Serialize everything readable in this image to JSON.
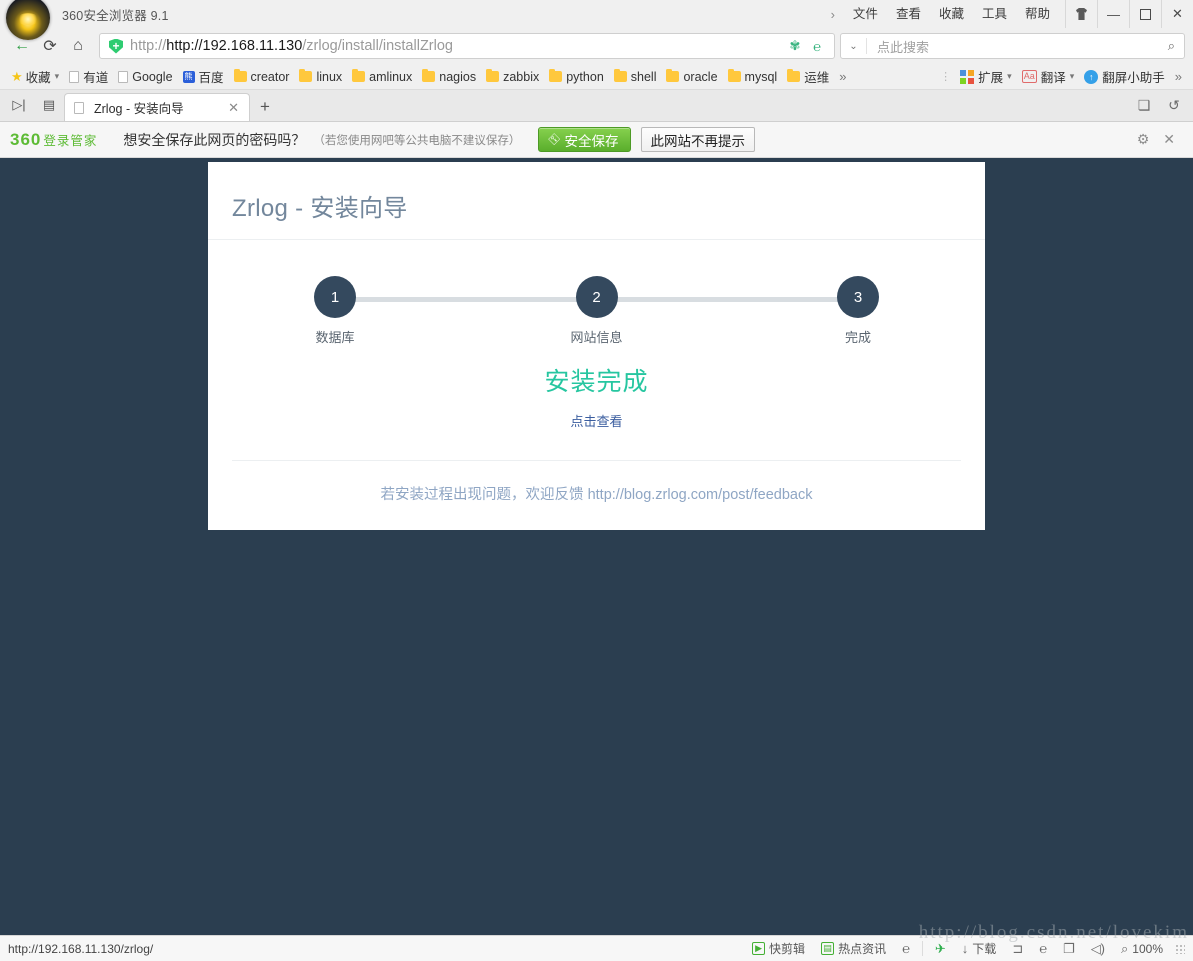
{
  "titlebar": {
    "app_title": "360安全浏览器 9.1",
    "logo_name": "360-browser-logo",
    "overflow_chevron": "›",
    "menus": [
      "文件",
      "查看",
      "收藏",
      "工具",
      "帮助"
    ],
    "window_buttons": {
      "skin": "",
      "minimize": "—",
      "maximize": "❐",
      "close": "✕"
    }
  },
  "navbar": {
    "back": "←",
    "reload": "⟳",
    "home": "⌂",
    "url_secure_part": "http://192.168.11.130",
    "url_path_part": "/zrlog/install/installZrlog",
    "url_full": "http://192.168.11.130/zrlog/install/installZrlog",
    "addr_icons": [
      "安全检测",
      "极速/兼容模式"
    ],
    "search": {
      "placeholder": "点此搜索",
      "dropdown": "⌄",
      "submit_icon": "search-icon"
    }
  },
  "bookmarks": {
    "root_label": "收藏",
    "items": [
      {
        "label": "有道",
        "type": "page"
      },
      {
        "label": "Google",
        "type": "page"
      },
      {
        "label": "百度",
        "type": "baidu"
      },
      {
        "label": "creator",
        "type": "folder"
      },
      {
        "label": "linux",
        "type": "folder"
      },
      {
        "label": "amlinux",
        "type": "folder"
      },
      {
        "label": "nagios",
        "type": "folder"
      },
      {
        "label": "zabbix",
        "type": "folder"
      },
      {
        "label": "python",
        "type": "folder"
      },
      {
        "label": "shell",
        "type": "folder"
      },
      {
        "label": "oracle",
        "type": "folder"
      },
      {
        "label": "mysql",
        "type": "folder"
      },
      {
        "label": "运维",
        "type": "folder"
      }
    ],
    "overflow": "»",
    "right_items": [
      {
        "label": "扩展",
        "icon": "extensions-icon",
        "caret": "▾"
      },
      {
        "label": "翻译",
        "icon": "translate-icon",
        "caret": "▾"
      },
      {
        "label": "翻屏小助手",
        "icon": "page-turn-icon",
        "caret": ""
      }
    ],
    "right_overflow": "»"
  },
  "tabstrip": {
    "lead_buttons": [
      "侧边栏",
      "手机预览"
    ],
    "tabs": [
      {
        "title": "Zrlog - 安装向导",
        "close": "✕",
        "active": true
      }
    ],
    "new_tab": "+",
    "right_buttons": [
      "窗口列表",
      "撤销关闭"
    ]
  },
  "password_bar": {
    "brand_main": "360",
    "brand_sub": "登录管家",
    "message": "想安全保存此网页的密码吗？",
    "hint": "（若您使用网吧等公共电脑不建议保存）",
    "save_button": "安全保存",
    "never_button": "此网站不再提示",
    "settings_icon": "⚙",
    "close_icon": "✕"
  },
  "page": {
    "title": "Zrlog - 安装向导",
    "steps": [
      {
        "number": "1",
        "label": "数据库"
      },
      {
        "number": "2",
        "label": "网站信息"
      },
      {
        "number": "3",
        "label": "完成"
      }
    ],
    "result_title": "安装完成",
    "result_link": "点击查看",
    "footer_text": "若安装过程出现问题，欢迎反馈 http://blog.zrlog.com/post/feedback",
    "colors": {
      "page_background": "#2b3e50",
      "card_background": "#ffffff",
      "title_color": "#73879c",
      "step_circle": "#34495e",
      "step_line": "#d8dde1",
      "success_green": "#26c6a0",
      "link_blue": "#3a5d9f",
      "footer_blue": "#8fa6c4"
    }
  },
  "statusbar": {
    "url": "http://192.168.11.130/zrlog/",
    "items": [
      {
        "label": "快剪辑",
        "icon": "video-edit-icon"
      },
      {
        "label": "热点资讯",
        "icon": "news-icon"
      },
      {
        "label": "",
        "icon": "ad-filter-icon"
      },
      {
        "label": "",
        "icon": "boost-icon"
      },
      {
        "label": "下载",
        "icon": "download-icon"
      },
      {
        "label": "",
        "icon": "screenshot-icon"
      },
      {
        "label": "",
        "icon": "compat-mode-icon"
      },
      {
        "label": "",
        "icon": "window-icon"
      },
      {
        "label": "",
        "icon": "sound-icon"
      }
    ],
    "zoom_icon": "zoom-icon",
    "zoom_level": "100%",
    "watermark": "http://blog.csdn.net/lovekim"
  }
}
